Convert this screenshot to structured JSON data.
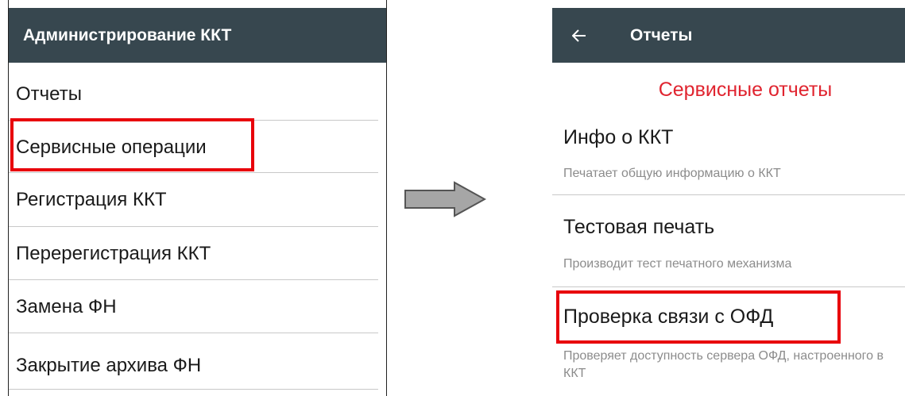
{
  "left_screen": {
    "title": "Администрирование ККТ",
    "items": [
      {
        "label": "Отчеты"
      },
      {
        "label": "Сервисные операции"
      },
      {
        "label": "Регистрация ККТ"
      },
      {
        "label": "Перерегистрация ККТ"
      },
      {
        "label": "Замена ФН"
      },
      {
        "label": "Закрытие архива ФН"
      }
    ],
    "highlighted_item": "Сервисные операции"
  },
  "right_screen": {
    "title": "Отчеты",
    "back_icon": "arrow-back-icon",
    "section_header": "Сервисные отчеты",
    "reports": [
      {
        "title": "Инфо о ККТ",
        "subtitle": "Печатает общую информацию о ККТ"
      },
      {
        "title": "Тестовая печать",
        "subtitle": "Производит тест печатного механизма"
      },
      {
        "title": "Проверка связи с ОФД",
        "subtitle": "Проверяет доступность сервера ОФД, настроенного в ККТ"
      }
    ],
    "highlighted_report": "Проверка связи с ОФД"
  },
  "colors": {
    "appbar": "#37474f",
    "highlight": "#e8000b",
    "section_header": "#e0242f",
    "arrow_fill": "#a6a6a6"
  }
}
